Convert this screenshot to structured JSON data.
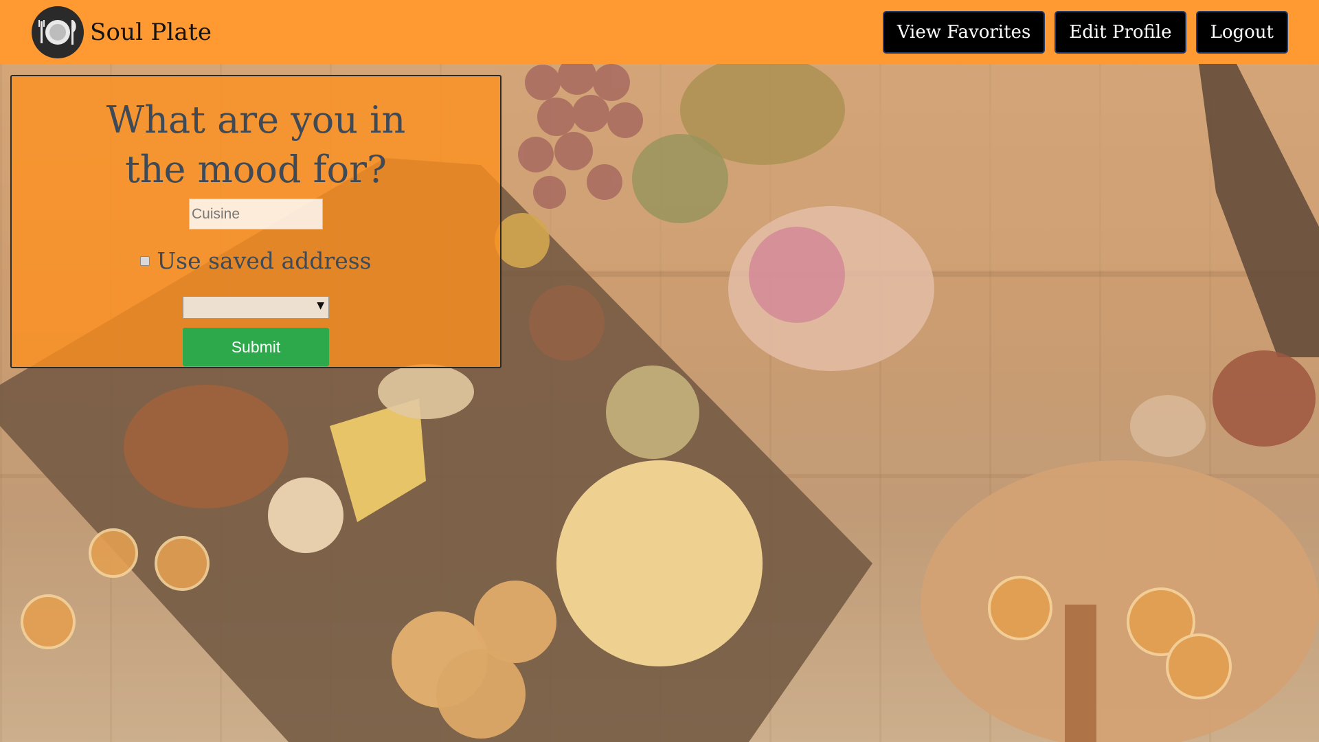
{
  "app": {
    "brand_name": "Soul Plate",
    "logo_icon": "plate-fork-knife-icon"
  },
  "nav": {
    "view_favorites_label": "View Favorites",
    "edit_profile_label": "Edit Profile",
    "logout_label": "Logout"
  },
  "form": {
    "title": "What are you in the mood for?",
    "cuisine_value": "",
    "cuisine_placeholder": "Cuisine",
    "use_saved_address_label": "Use saved address",
    "use_saved_address_checked": false,
    "address_selected": "",
    "submit_label": "Submit"
  },
  "colors": {
    "navbar": "#ff9a33",
    "nav_button_bg": "#000000",
    "panel": "#ff911e",
    "submit": "#2da84a",
    "title_text": "#3e4a57"
  }
}
